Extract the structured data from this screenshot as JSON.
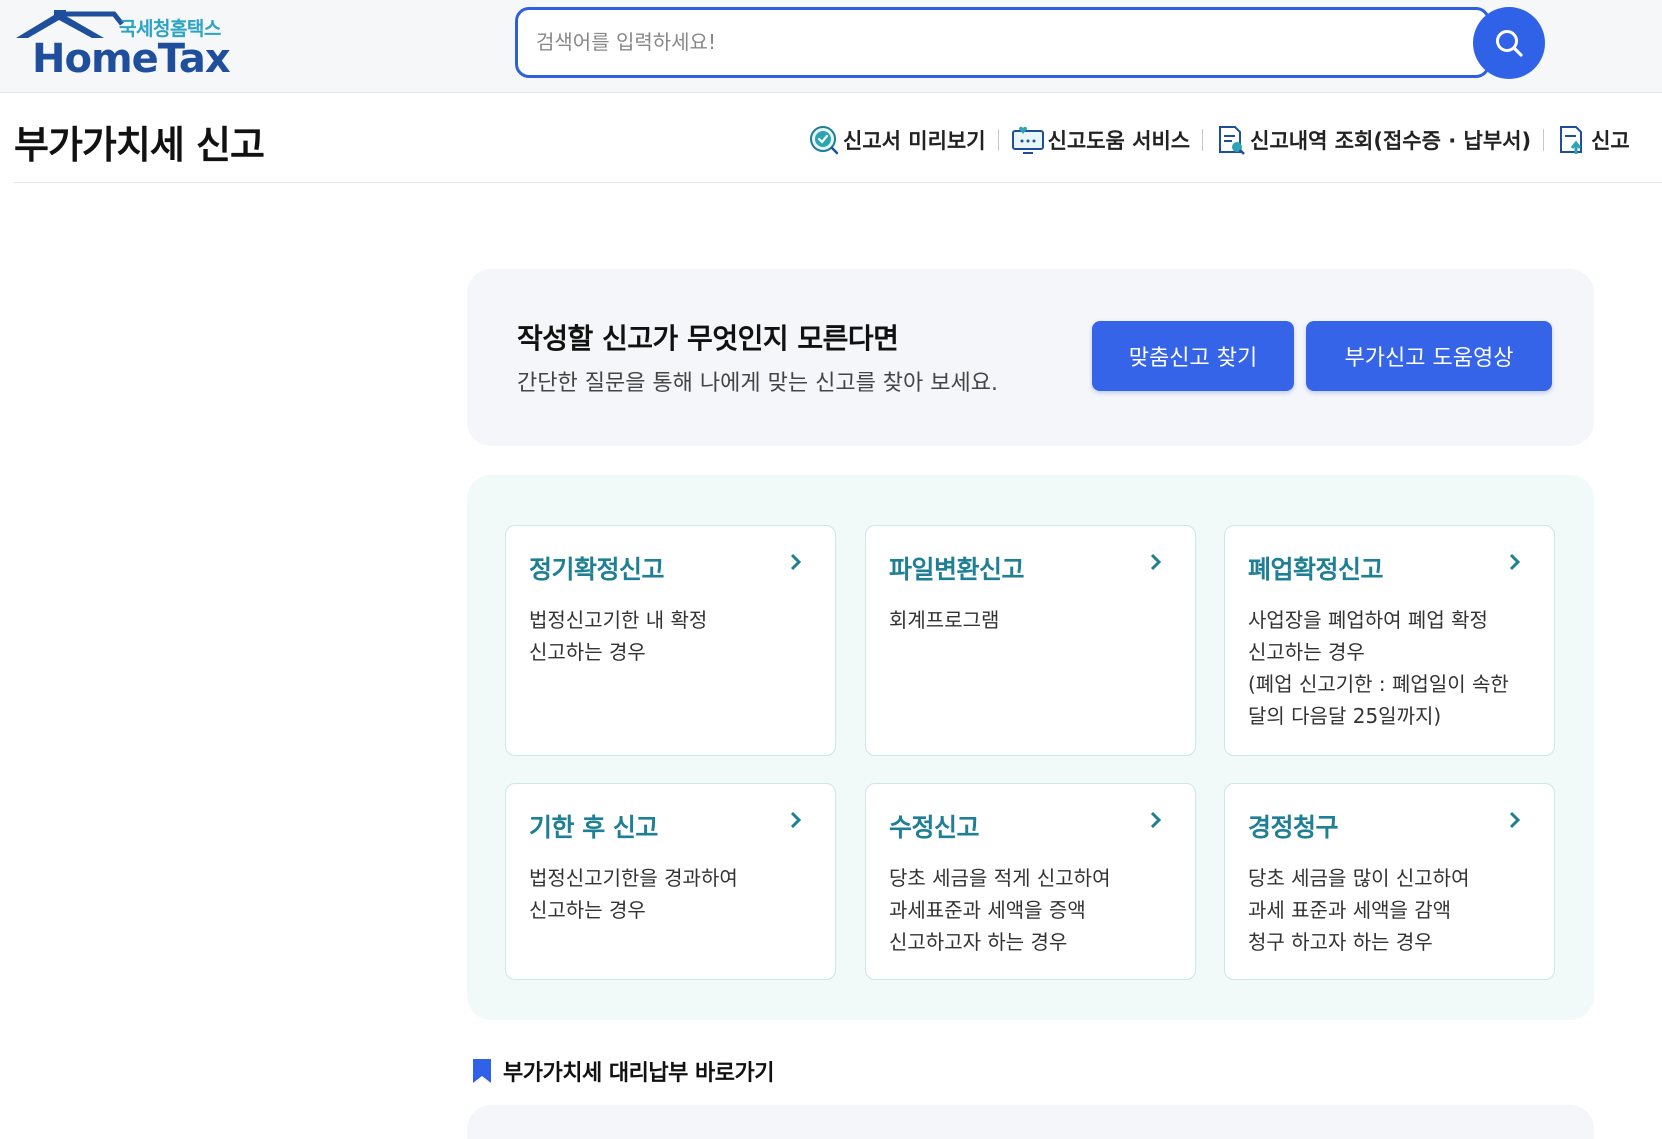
{
  "header": {
    "logo_sub": "국세청홈택스",
    "logo_main": "HomeTax",
    "search_placeholder": "검색어를 입력하세요!",
    "search_value": ""
  },
  "page": {
    "title": "부가가치세 신고",
    "quick_links": [
      {
        "label": "신고서 미리보기",
        "icon": "preview-check-icon"
      },
      {
        "label": "신고도움 서비스",
        "icon": "monitor-help-icon"
      },
      {
        "label": "신고내역 조회(접수증 · 납부서)",
        "icon": "document-search-icon"
      },
      {
        "label": "신고",
        "icon": "document-upload-icon"
      }
    ]
  },
  "intro": {
    "title": "작성할 신고가 무엇인지 모른다면",
    "desc": "간단한 질문을 통해 나에게 맞는 신고를 찾아 보세요.",
    "btn_find": "맞춤신고 찾기",
    "btn_video": "부가신고 도움영상"
  },
  "cards": [
    {
      "title": "정기확정신고",
      "lines": [
        "법정신고기한 내 확정",
        "신고하는 경우"
      ]
    },
    {
      "title": "파일변환신고",
      "lines": [
        "회계프로그램"
      ]
    },
    {
      "title": "폐업확정신고",
      "lines": [
        "사업장을 폐업하여 폐업 확정",
        "신고하는 경우",
        "(폐업 신고기한 : 폐업일이 속한",
        "달의 다음달 25일까지)"
      ]
    },
    {
      "title": "기한 후 신고",
      "lines": [
        "법정신고기한을 경과하여",
        "신고하는 경우"
      ]
    },
    {
      "title": "수정신고",
      "lines": [
        "당초 세금을 적게 신고하여",
        "과세표준과 세액을 증액",
        "신고하고자 하는 경우"
      ]
    },
    {
      "title": "경정청구",
      "lines": [
        "당초 세금을 많이 신고하여",
        "과세 표준과 세액을 감액",
        "청구 하고자 하는 경우"
      ]
    }
  ],
  "section": {
    "title": "부가가치세 대리납부 바로가기"
  },
  "colors": {
    "accent": "#3564e8",
    "card_title": "#1f7f94",
    "cards_bg": "#f1f9f9"
  }
}
